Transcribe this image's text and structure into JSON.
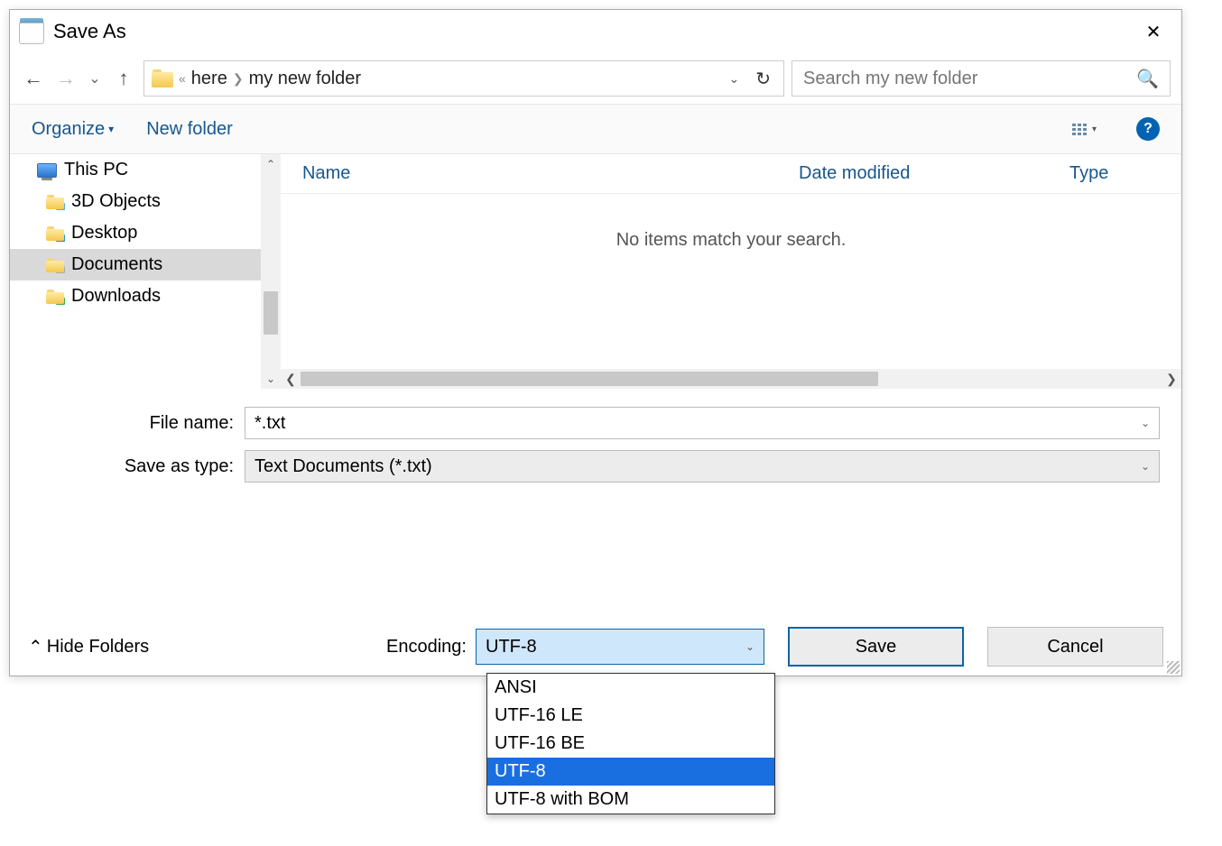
{
  "titlebar": {
    "title": "Save As"
  },
  "nav": {
    "breadcrumb_prefix": "«",
    "crumb1": "here",
    "crumb2": "my new folder"
  },
  "search": {
    "placeholder": "Search my new folder"
  },
  "toolbar": {
    "organize": "Organize",
    "new_folder": "New folder"
  },
  "sidebar": {
    "this_pc": "This PC",
    "items": [
      {
        "label": "3D Objects"
      },
      {
        "label": "Desktop"
      },
      {
        "label": "Documents"
      },
      {
        "label": "Downloads"
      }
    ]
  },
  "columns": {
    "name": "Name",
    "date_modified": "Date modified",
    "type": "Type"
  },
  "empty_message": "No items match your search.",
  "fields": {
    "file_name_label": "File name:",
    "file_name_value": "*.txt",
    "save_as_type_label": "Save as type:",
    "save_as_type_value": "Text Documents (*.txt)"
  },
  "footer": {
    "hide_folders": "Hide Folders",
    "encoding_label": "Encoding:",
    "encoding_value": "UTF-8",
    "encoding_options": [
      "ANSI",
      "UTF-16 LE",
      "UTF-16 BE",
      "UTF-8",
      "UTF-8 with BOM"
    ],
    "encoding_selected_index": 3,
    "save": "Save",
    "cancel": "Cancel"
  }
}
